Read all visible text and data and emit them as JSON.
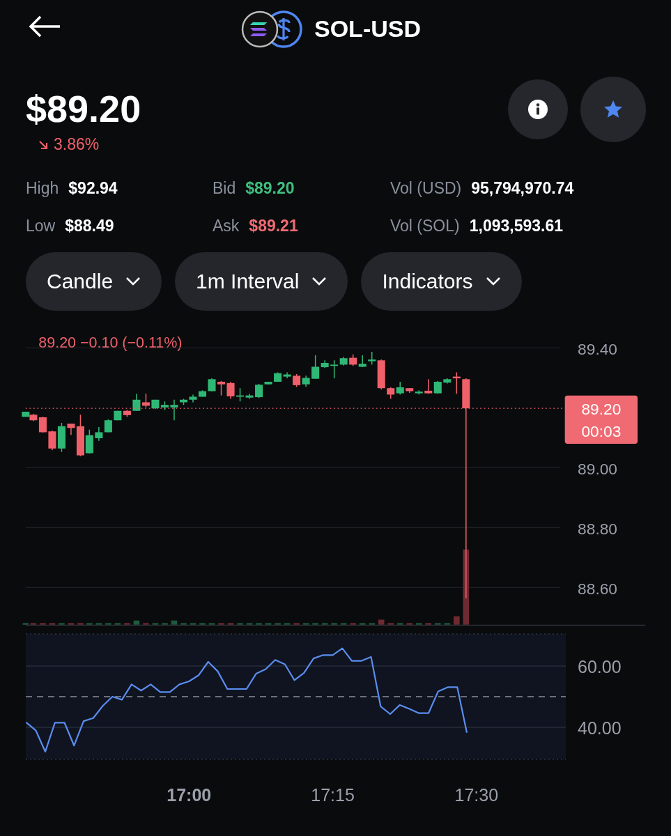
{
  "header": {
    "title": "SOL-USD"
  },
  "price": "$89.20",
  "change": {
    "text": "3.86%"
  },
  "stats_rows": [
    {
      "cells": [
        {
          "label": "High",
          "value": "$92.94",
          "color": "#ffffff"
        },
        {
          "label": "Bid",
          "value": "$89.20",
          "color": "#3fbf7f"
        },
        {
          "label": "Vol (USD)",
          "value": "95,794,970.74",
          "color": "#ffffff"
        }
      ]
    },
    {
      "cells": [
        {
          "label": "Low",
          "value": "$88.49",
          "color": "#ffffff"
        },
        {
          "label": "Ask",
          "value": "$89.21",
          "color": "#f06b73"
        },
        {
          "label": "Vol (SOL)",
          "value": "1,093,593.61",
          "color": "#ffffff"
        }
      ]
    }
  ],
  "selectors": [
    {
      "label": "Candle"
    },
    {
      "label": "1m Interval"
    },
    {
      "label": "Indicators"
    }
  ],
  "price_chart": {
    "legend": "89.20  −0.10 (−0.11%)",
    "axis_labels": [
      "89.40",
      "89.00",
      "88.80",
      "88.60"
    ],
    "price_tag": {
      "price": "89.20",
      "countdown": "00:03"
    }
  },
  "rsi_chart": {
    "chart_data": {
      "type": "line",
      "categories": [
        null,
        null,
        null,
        null,
        null,
        null,
        null,
        null,
        null,
        null,
        null,
        null,
        null,
        null,
        null,
        null,
        null,
        "17:00",
        null,
        null,
        null,
        null,
        null,
        null,
        null,
        null,
        null,
        null,
        null,
        null,
        null,
        null,
        "17:15",
        null,
        null,
        null,
        null,
        null,
        null,
        null,
        null,
        null,
        null,
        null,
        null,
        null,
        null,
        "17:30"
      ],
      "series": [
        {
          "color": "#5b8def",
          "values": [
            41.6,
            39,
            32,
            41.5,
            41.5,
            34,
            42,
            43,
            47,
            50,
            49,
            54,
            52,
            54,
            51.5,
            51.5,
            54,
            55,
            57,
            61.4,
            58.3,
            52.5,
            52.5,
            52.5,
            57.5,
            59,
            62,
            60.6,
            55.4,
            57.8,
            62.5,
            63.6,
            63.6,
            65.8,
            61.7,
            61.7,
            63,
            46.8,
            44.3,
            47.3,
            46,
            44.6,
            44.6,
            51.7,
            53.1,
            53.1,
            38.2,
            null
          ]
        }
      ],
      "ylim": [
        29.5,
        70.5
      ],
      "yticks": [
        {
          "value": 40,
          "label": "40.00"
        },
        {
          "value": 60,
          "label": "60.00"
        }
      ],
      "ref_lines": [
        {
          "axis": "y",
          "value": 50
        }
      ]
    }
  }
}
